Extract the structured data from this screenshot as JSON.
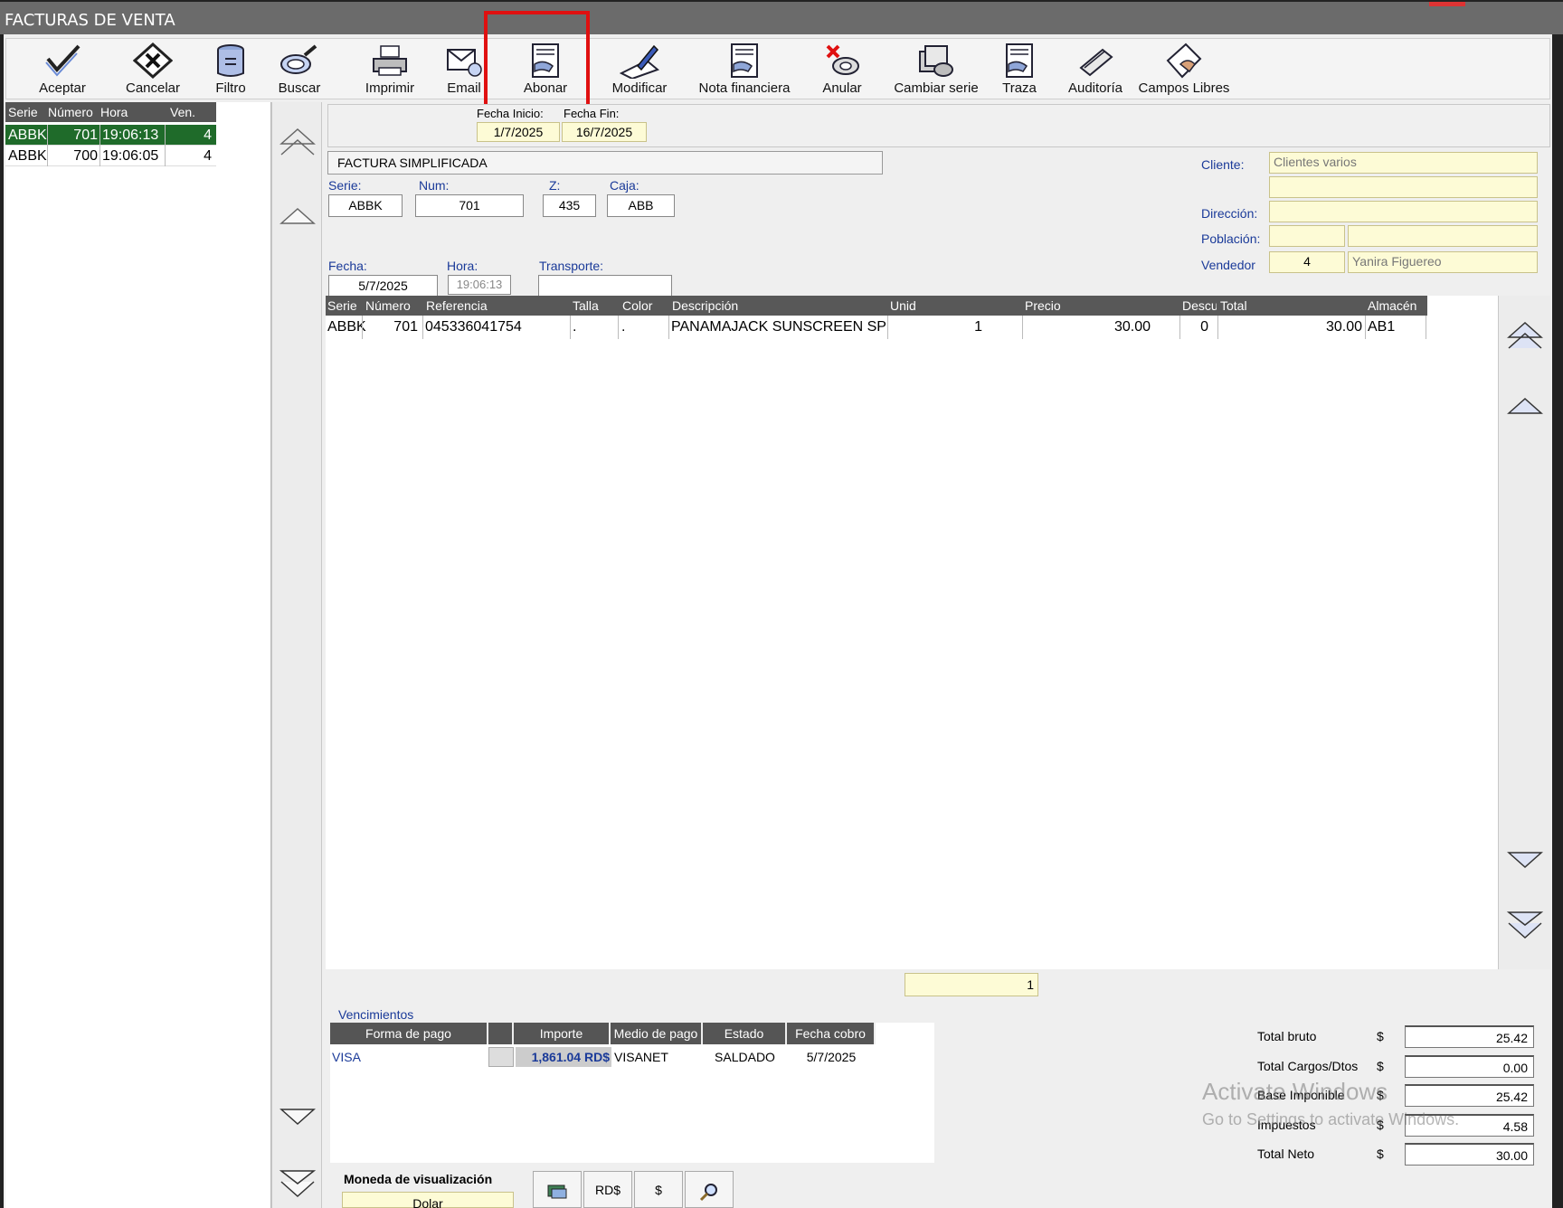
{
  "window": {
    "title": "FACTURAS DE VENTA"
  },
  "toolbar": {
    "buttons": [
      {
        "label": "Aceptar",
        "icon": "accept-check-icon"
      },
      {
        "label": "Cancelar",
        "icon": "cancel-x-icon"
      },
      {
        "label": "Filtro",
        "icon": "filter-icon"
      },
      {
        "label": "Buscar",
        "icon": "search-magnifier-icon"
      },
      {
        "label": "Imprimir",
        "icon": "printer-icon"
      },
      {
        "label": "Email",
        "icon": "email-icon"
      },
      {
        "label": "Abonar",
        "icon": "credit-note-icon"
      },
      {
        "label": "Modificar",
        "icon": "edit-pen-icon"
      },
      {
        "label": "Nota financiera",
        "icon": "financial-note-icon"
      },
      {
        "label": "Anular",
        "icon": "void-icon"
      },
      {
        "label": "Cambiar serie",
        "icon": "change-series-icon"
      },
      {
        "label": "Traza",
        "icon": "trace-icon"
      },
      {
        "label": "Auditoría",
        "icon": "audit-icon"
      },
      {
        "label": "Campos Libres",
        "icon": "free-fields-icon"
      }
    ],
    "highlighted": "Abonar",
    "highlight_color": "#e01010"
  },
  "invoice_list": {
    "headers": [
      "Serie",
      "Número",
      "Hora",
      "Ven."
    ],
    "rows": [
      {
        "serie": "ABBK",
        "numero": "701",
        "hora": "19:06:13",
        "ven": "4",
        "selected": true
      },
      {
        "serie": "ABBK",
        "numero": "700",
        "hora": "19:06:05",
        "ven": "4",
        "selected": false
      }
    ],
    "selected_color": "#1f6b2a"
  },
  "date_range": {
    "start_label": "Fecha Inicio:",
    "start_value": "1/7/2025",
    "end_label": "Fecha Fin:",
    "end_value": "16/7/2025"
  },
  "header_form": {
    "doc_type": "FACTURA SIMPLIFICADA",
    "serie_label": "Serie:",
    "serie_value": "ABBK",
    "num_label": "Num:",
    "num_value": "701",
    "z_label": "Z:",
    "z_value": "435",
    "caja_label": "Caja:",
    "caja_value": "ABB",
    "fecha_label": "Fecha:",
    "fecha_value": "5/7/2025",
    "hora_label": "Hora:",
    "hora_value": "19:06:13",
    "transporte_label": "Transporte:",
    "transporte_value": ""
  },
  "client": {
    "cliente_label": "Cliente:",
    "cliente_value": "Clientes varios",
    "direccion_label": "Dirección:",
    "poblacion_label": "Población:",
    "vendedor_label": "Vendedor",
    "vendedor_code": "4",
    "vendedor_name": "Yanira Figuereo"
  },
  "lines_grid": {
    "headers": [
      "Serie",
      "Número",
      "Referencia",
      "Talla",
      "Color",
      "Descripción",
      "Unid",
      "Precio",
      "Descu",
      "Total",
      "Almacén"
    ],
    "rows": [
      {
        "serie": "ABBK",
        "numero": "701",
        "referencia": "045336041754",
        "talla": ".",
        "color": ".",
        "descripcion": "PANAMAJACK SUNSCREEN SPRA",
        "unid": "1",
        "precio": "30.00",
        "descu": "0",
        "total": "30.00",
        "almacen": "AB1"
      }
    ],
    "line_count": "1"
  },
  "vencimientos": {
    "title": "Vencimientos",
    "headers": [
      "Forma de pago",
      "",
      "Importe",
      "Medio de pago",
      "Estado",
      "Fecha cobro"
    ],
    "rows": [
      {
        "forma": "VISA",
        "importe": "1,861.04 RD$",
        "medio": "VISANET",
        "estado": "SALDADO",
        "fecha": "5/7/2025"
      }
    ]
  },
  "totals": [
    {
      "label": "Total bruto",
      "currency": "$",
      "value": "25.42"
    },
    {
      "label": "Total Cargos/Dtos",
      "currency": "$",
      "value": "0.00"
    },
    {
      "label": "Base Imponible",
      "currency": "$",
      "value": "25.42"
    },
    {
      "label": "Impuestos",
      "currency": "$",
      "value": "4.58"
    },
    {
      "label": "Total Neto",
      "currency": "$",
      "value": "30.00"
    }
  ],
  "currency_view": {
    "label": "Moneda de visualización",
    "value": "Dolar",
    "buttons": [
      "",
      "RD$",
      "$",
      ""
    ]
  },
  "watermark": {
    "line1": "Activate Windows",
    "line2": "Go to Settings to activate Windows."
  }
}
